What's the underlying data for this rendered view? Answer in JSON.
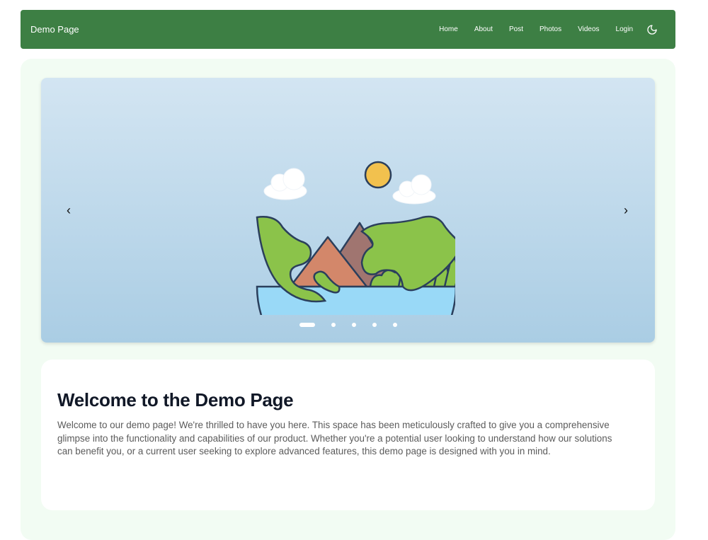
{
  "nav": {
    "brand": "Demo Page",
    "links": [
      "Home",
      "About",
      "Post",
      "Photos",
      "Videos",
      "Login"
    ],
    "theme_icon": "moon-icon"
  },
  "carousel": {
    "prev_icon": "chevron-left-icon",
    "next_icon": "chevron-right-icon",
    "prev_symbol": "‹",
    "next_symbol": "›",
    "slide_count": 5,
    "active_slide": 1,
    "image_icon": "earth-landscape-illustration"
  },
  "content": {
    "title": "Welcome to the Demo Page",
    "body": "Welcome to our demo page! We're thrilled to have you here. This space has been meticulously crafted to give you a comprehensive glimpse into the functionality and capabilities of our product. Whether you're a potential user looking to understand how our solutions can benefit you, or a current user seeking to explore advanced features, this demo page is designed with you in mind."
  },
  "colors": {
    "navbar": "#3d7f44",
    "container": "#f2fcf3",
    "carousel_top": "#d3e5f2",
    "carousel_bottom": "#aacde4",
    "title": "#111827",
    "body_text": "#5b5b5b"
  }
}
